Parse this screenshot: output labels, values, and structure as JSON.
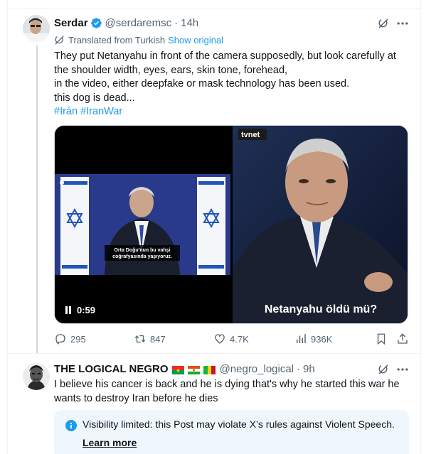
{
  "tweet1": {
    "name": "Serdar",
    "handle": "@serdaremsc",
    "dot": "·",
    "time": "14h",
    "translated_label": "Translated from Turkish",
    "show_original": "Show original",
    "text_lines": [
      "They put Netanyahu in front of the camera supposedly, but look carefully at",
      "the shoulder width, eyes, ears, skin tone, forehead,",
      "in the video, either deepfake or mask technology has been used.",
      "this dog is dead..."
    ],
    "hashtags": [
      "#Irán",
      "#IranWar"
    ],
    "video_duration": "0:59",
    "left_subtitle": "Orta Doğu'nun bu vahşi\ncoğrafyasında yaşıyoruz.",
    "right_channel": "tvnet",
    "right_caption": "Netanyahu öldü mü?",
    "stats": {
      "replies": "295",
      "reposts": "847",
      "likes": "4.7K",
      "views": "936K"
    }
  },
  "tweet2": {
    "name": "THE LOGICAL NEGRO",
    "handle": "@negro_logical",
    "dot": "·",
    "time": "9h",
    "text_lines": [
      "I believe his cancer is back and he is dying that's why he started this war he",
      "wants to destroy Iran before he dies"
    ],
    "notice_text": "Visibility limited: this Post may violate X’s rules against Violent Speech.",
    "learn_more": "Learn more"
  },
  "colors": {
    "accent": "#1d9bf0",
    "muted": "#536471",
    "notice_bg": "#f0f7fc"
  },
  "icons": [
    "verified-badge-icon",
    "grok-icon",
    "more-icon",
    "translate-icon",
    "pause-icon",
    "reply-icon",
    "repost-icon",
    "like-icon",
    "views-icon",
    "bookmark-icon",
    "share-icon",
    "info-icon"
  ]
}
